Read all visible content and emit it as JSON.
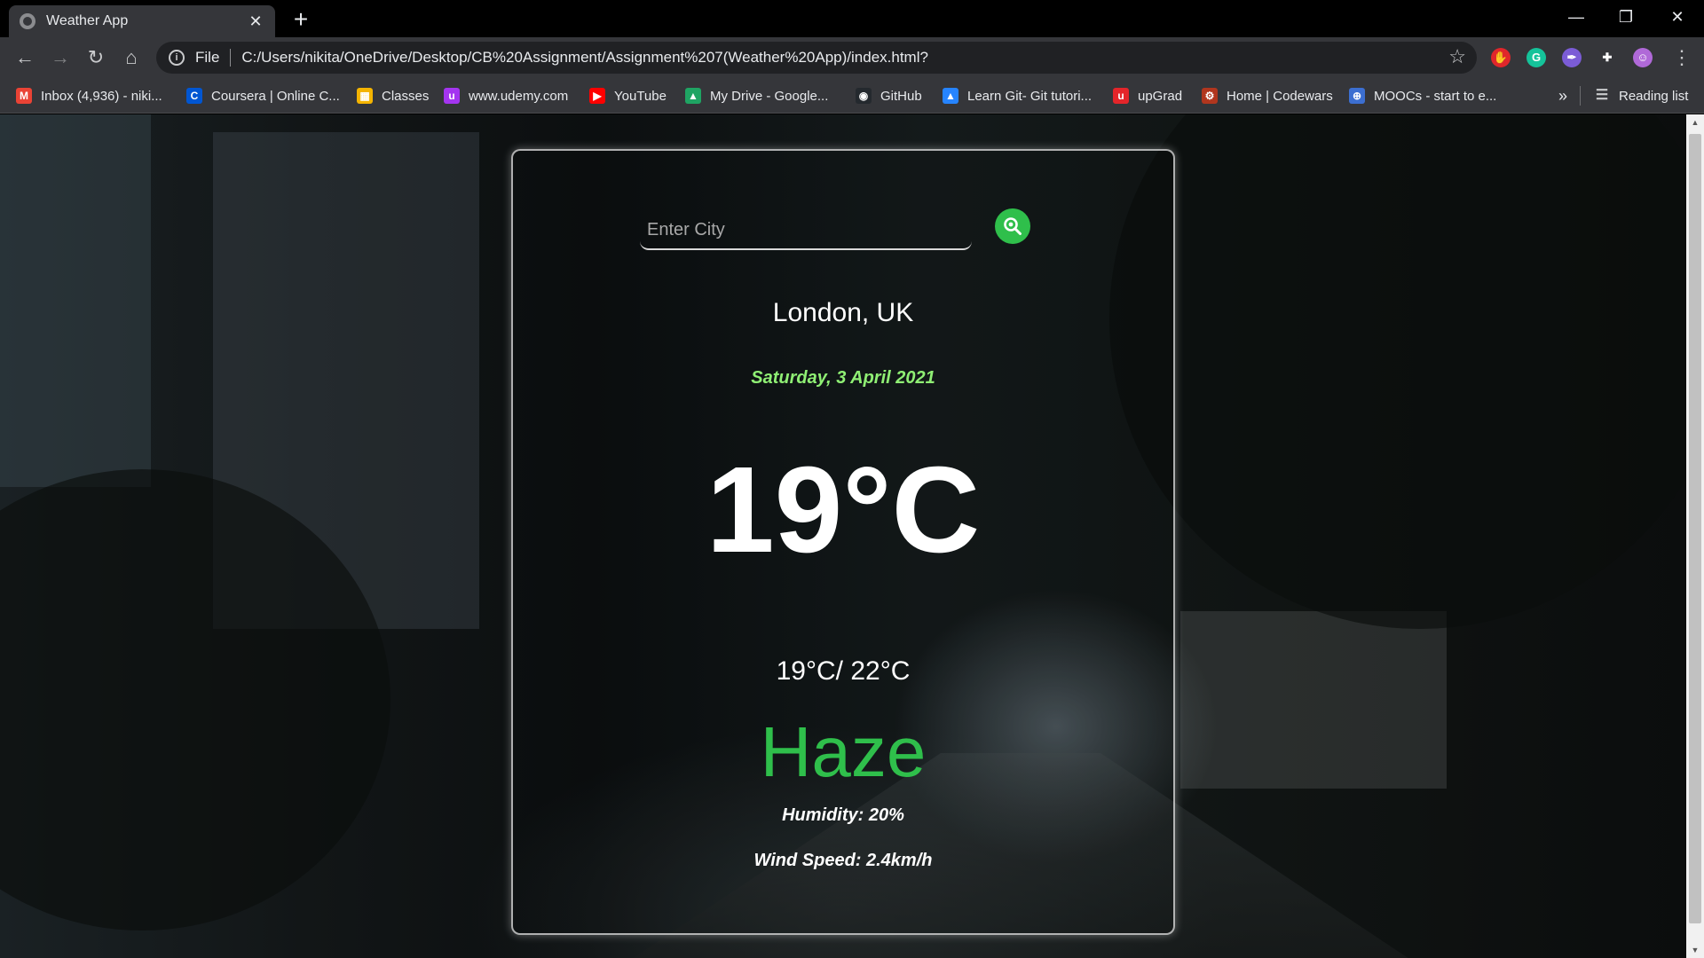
{
  "browser": {
    "tab_title": "Weather App",
    "tab_close": "✕",
    "new_tab": "+",
    "window": {
      "minimize": "—",
      "restore": "❐",
      "close": "✕"
    },
    "nav": {
      "back": "←",
      "forward": "→",
      "reload": "↻",
      "home": "⌂"
    },
    "address": {
      "scheme": "File",
      "url": "C:/Users/nikita/OneDrive/Desktop/CB%20Assignment/Assignment%207(Weather%20App)/index.html?",
      "info_glyph": "i",
      "star": "☆"
    },
    "extensions": [
      {
        "icon": "adblock-icon",
        "color": "#e0262b",
        "glyph": "✋"
      },
      {
        "icon": "grammarly-icon",
        "color": "#15c39a",
        "glyph": "G"
      },
      {
        "icon": "feather-icon",
        "color": "#7b5cd6",
        "glyph": "✒"
      },
      {
        "icon": "puzzle-icon",
        "color": "#35363a",
        "glyph": "✚"
      },
      {
        "icon": "profile-avatar",
        "color": "#b069d8",
        "glyph": "☺"
      }
    ],
    "menu_glyph": "⋮",
    "bookmarks": [
      {
        "label": "Inbox (4,936) - niki...",
        "icon": "gmail-icon",
        "color": "#ea4335",
        "glyph": "M"
      },
      {
        "label": "Coursera | Online C...",
        "icon": "coursera-icon",
        "color": "#0056d2",
        "glyph": "C"
      },
      {
        "label": "Classes",
        "icon": "classroom-icon",
        "color": "#f4b400",
        "glyph": "▦"
      },
      {
        "label": "www.udemy.com",
        "icon": "udemy-icon",
        "color": "#a435f0",
        "glyph": "u"
      },
      {
        "label": "YouTube",
        "icon": "youtube-icon",
        "color": "#ff0000",
        "glyph": "▶"
      },
      {
        "label": "My Drive - Google...",
        "icon": "drive-icon",
        "color": "#1fa463",
        "glyph": "▲"
      },
      {
        "label": "GitHub",
        "icon": "github-icon",
        "color": "#24292e",
        "glyph": "◉"
      },
      {
        "label": "Learn Git- Git tutori...",
        "icon": "atlassian-icon",
        "color": "#2684ff",
        "glyph": "▲"
      },
      {
        "label": "upGrad",
        "icon": "upgrad-icon",
        "color": "#e4252a",
        "glyph": "u"
      },
      {
        "label": "Home | Codewars",
        "icon": "codewars-icon",
        "color": "#b1361e",
        "glyph": "⚙"
      },
      {
        "label": "MOOCs - start to e...",
        "icon": "moocs-icon",
        "color": "#3c6fd1",
        "glyph": "⊕"
      }
    ],
    "bookmarks_overflow": "»",
    "reading_list": "Reading list",
    "reading_list_glyph": "☰"
  },
  "weather": {
    "search_placeholder": "Enter City",
    "search_value": "",
    "city": "London, UK",
    "date": "Saturday, 3 April 2021",
    "temperature": "19°C",
    "min_max": "19°C/ 22°C",
    "condition": "Haze",
    "humidity": "Humidity: 20%",
    "wind": "Wind Speed: 2.4km/h"
  },
  "colors": {
    "accent_green": "#2fbf4b",
    "date_green": "#8fef74",
    "chrome_dark": "#35363a"
  }
}
